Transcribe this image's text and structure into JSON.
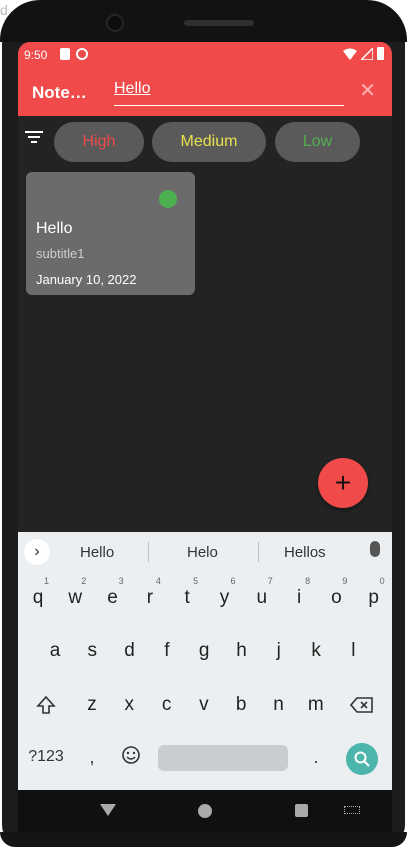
{
  "device": {
    "edge_text": "d"
  },
  "status_bar": {
    "time": "9:50"
  },
  "app_bar": {
    "title": "Note…",
    "search_value": "Hello",
    "close_icon": "close-icon",
    "color": "#f04a4a"
  },
  "filters": {
    "icon": "filter-icon",
    "items": [
      {
        "label": "High",
        "color": "#f04a4a"
      },
      {
        "label": "Medium",
        "color": "#e9e04f"
      },
      {
        "label": "Low",
        "color": "#51b04f"
      }
    ]
  },
  "notes": [
    {
      "title": "Hello",
      "subtitle": "subtitle1",
      "date": "January 10, 2022",
      "priority_color": "#4caf50"
    }
  ],
  "fab": {
    "label": "+"
  },
  "keyboard": {
    "suggestions": [
      "Hello",
      "Helo",
      "Hellos"
    ],
    "row1": [
      {
        "key": "q",
        "num": "1"
      },
      {
        "key": "w",
        "num": "2"
      },
      {
        "key": "e",
        "num": "3"
      },
      {
        "key": "r",
        "num": "4"
      },
      {
        "key": "t",
        "num": "5"
      },
      {
        "key": "y",
        "num": "6"
      },
      {
        "key": "u",
        "num": "7"
      },
      {
        "key": "i",
        "num": "8"
      },
      {
        "key": "o",
        "num": "9"
      },
      {
        "key": "p",
        "num": "0"
      }
    ],
    "row2": [
      "a",
      "s",
      "d",
      "f",
      "g",
      "h",
      "j",
      "k",
      "l"
    ],
    "row3": [
      "z",
      "x",
      "c",
      "v",
      "b",
      "n",
      "m"
    ],
    "sym_label": "?123",
    "comma": ",",
    "period": "."
  }
}
